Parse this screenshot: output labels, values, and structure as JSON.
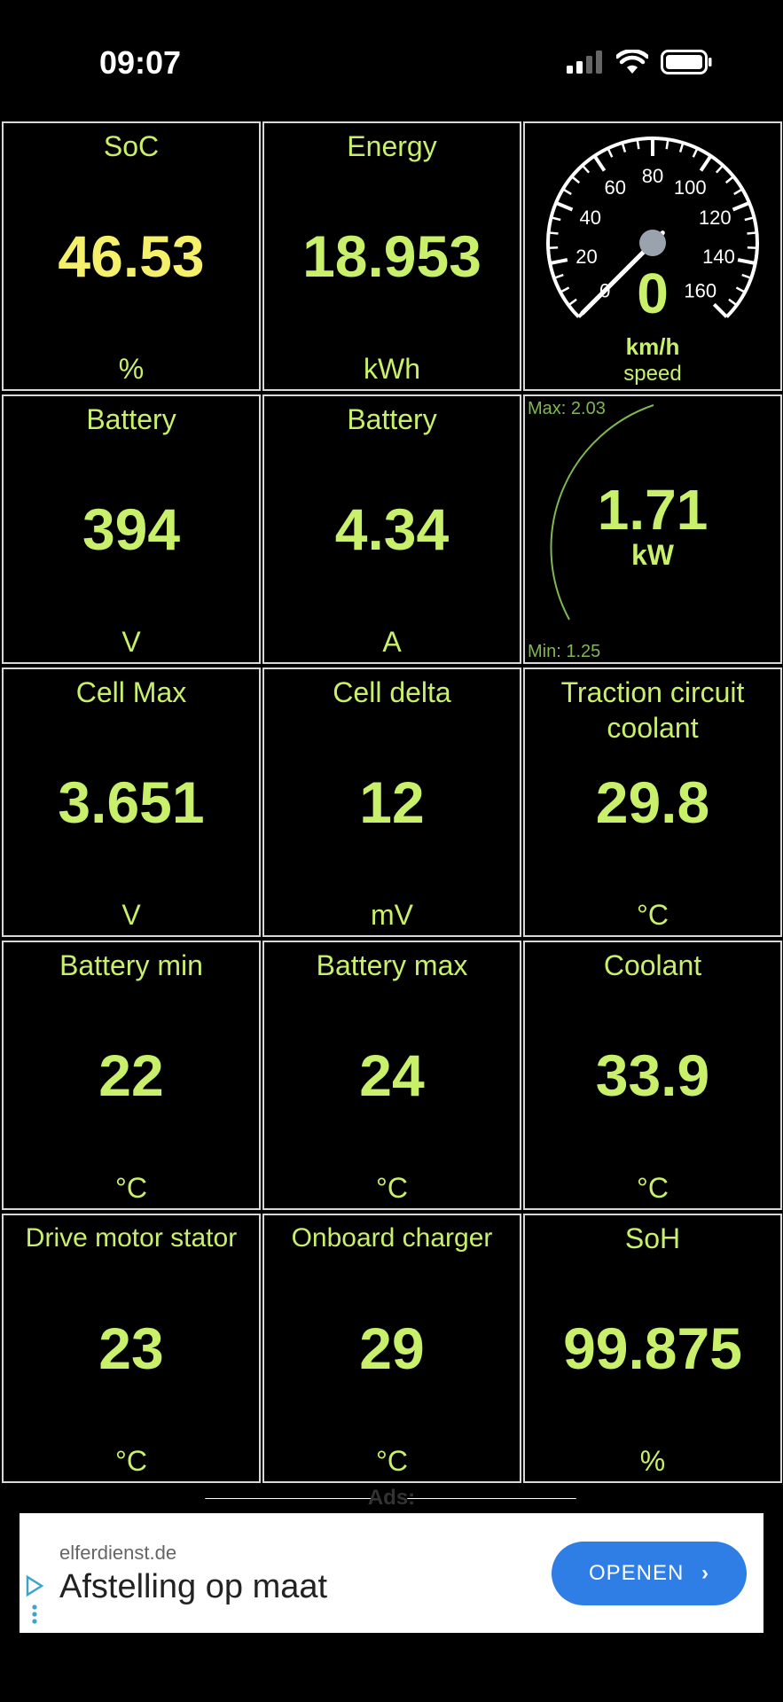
{
  "status_bar": {
    "time": "09:07"
  },
  "tiles": [
    {
      "title": "SoC",
      "value": "46.53",
      "unit": "%"
    },
    {
      "title": "Energy",
      "value": "18.953",
      "unit": "kWh"
    },
    {
      "title": "",
      "value": "",
      "unit": ""
    },
    {
      "title": "Battery",
      "value": "394",
      "unit": "V"
    },
    {
      "title": "Battery",
      "value": "4.34",
      "unit": "A"
    },
    {
      "title": "",
      "value": "",
      "unit": ""
    },
    {
      "title": "Cell Max",
      "value": "3.651",
      "unit": "V"
    },
    {
      "title": "Cell delta",
      "value": "12",
      "unit": "mV"
    },
    {
      "title": "Traction circuit coolant",
      "value": "29.8",
      "unit": "°C"
    },
    {
      "title": "Battery min",
      "value": "22",
      "unit": "°C"
    },
    {
      "title": "Battery max",
      "value": "24",
      "unit": "°C"
    },
    {
      "title": "Coolant",
      "value": "33.9",
      "unit": "°C"
    },
    {
      "title": "Drive motor stator",
      "value": "23",
      "unit": "°C"
    },
    {
      "title": "Onboard charger",
      "value": "29",
      "unit": "°C"
    },
    {
      "title": "SoH",
      "value": "99.875",
      "unit": "%"
    }
  ],
  "speedometer": {
    "value": "0",
    "unit": "km/h",
    "label": "speed",
    "ticks": [
      "0",
      "20",
      "40",
      "60",
      "80",
      "100",
      "120",
      "140",
      "160"
    ],
    "speed_value": 0
  },
  "power_gauge": {
    "value": "1.71",
    "unit": "kW",
    "max_label": "Max: 2.03",
    "min_label": "Min: 1.25"
  },
  "ads": {
    "label": "Ads:",
    "site": "elferdienst.de",
    "title": "Afstelling op maat",
    "button": "OPENEN"
  },
  "colors": {
    "accent": "#c9f06a",
    "soc": "#f4f06a",
    "ad_button": "#2f7ee6"
  }
}
